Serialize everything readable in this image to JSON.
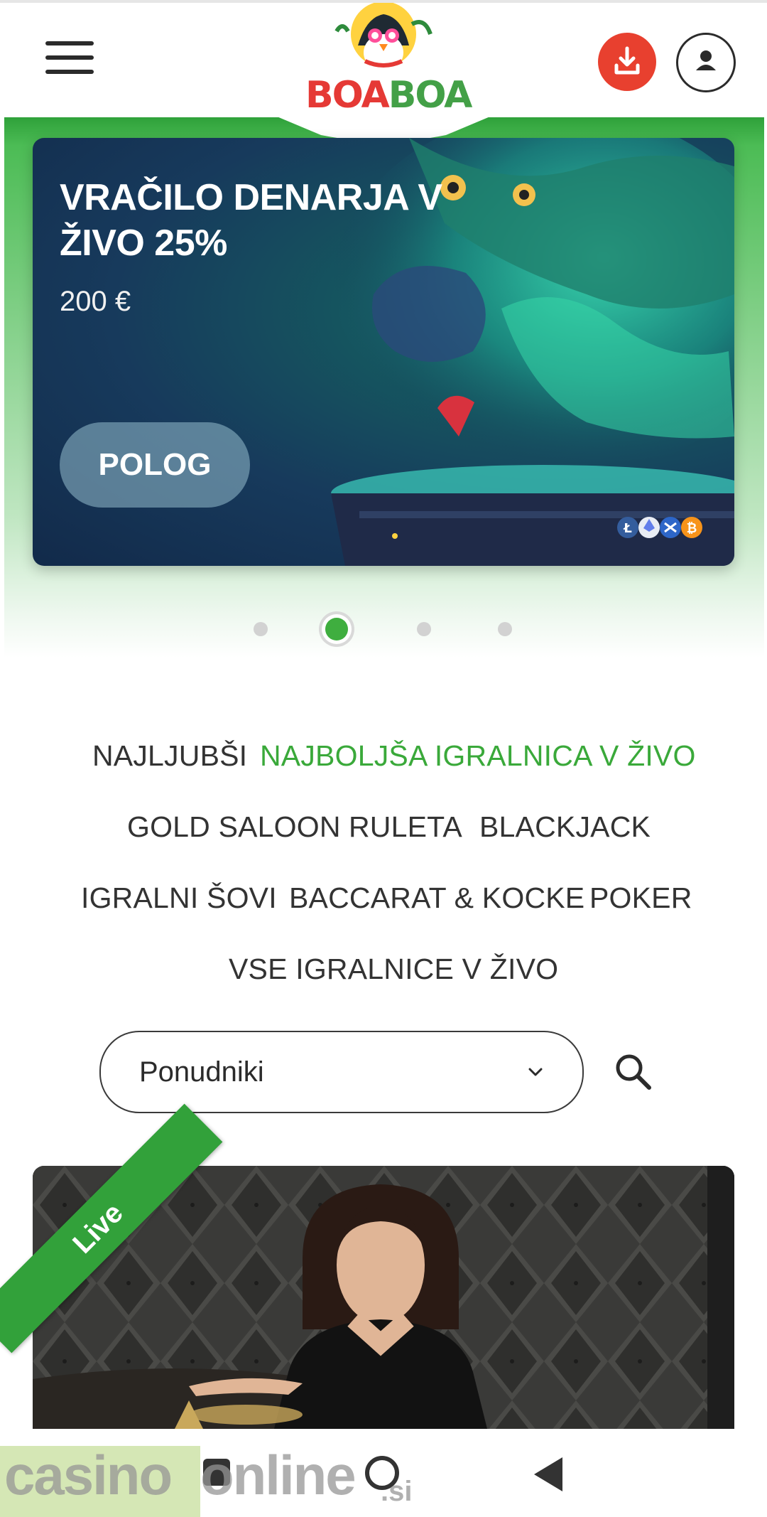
{
  "header": {
    "logo_text_part1": "BOA",
    "logo_text_part2": "BOA",
    "brand_colors": {
      "red": "#e53935",
      "green": "#43a047"
    },
    "menu_icon": "hamburger-menu-icon",
    "download_icon": "download-icon",
    "user_icon": "user-icon"
  },
  "banner": {
    "title": "VRAČILO DENARJA V ŽIVO 25%",
    "amount": "200 €",
    "cta_label": "POLOG",
    "badges": [
      "litecoin-icon",
      "ethereum-icon",
      "ripple-icon",
      "bitcoin-icon"
    ]
  },
  "carousel": {
    "total": 4,
    "active_index": 2
  },
  "categories": [
    {
      "label": "NAJLJUBŠI",
      "active": false
    },
    {
      "label": "NAJBOLJŠA IGRALNICA V ŽIVO",
      "active": true
    },
    {
      "label": "GOLD SALOON",
      "active": false
    },
    {
      "label": "RULETA",
      "active": false
    },
    {
      "label": "BLACKJACK",
      "active": false
    },
    {
      "label": "IGRALNI ŠOVI",
      "active": false
    },
    {
      "label": "BACCARAT & KOCKE",
      "active": false
    },
    {
      "label": "POKER",
      "active": false
    },
    {
      "label": "VSE IGRALNICE V ŽIVO",
      "active": false
    }
  ],
  "filters": {
    "provider_selected": "Ponudniki",
    "search_icon": "search-icon"
  },
  "game_card": {
    "badge": "Live"
  },
  "watermark": {
    "part1": "casino",
    "part2": "online",
    "part3": ".si"
  },
  "colors": {
    "accent_green": "#3aa93a",
    "download_red": "#e8402f",
    "text_dark": "#333333"
  }
}
